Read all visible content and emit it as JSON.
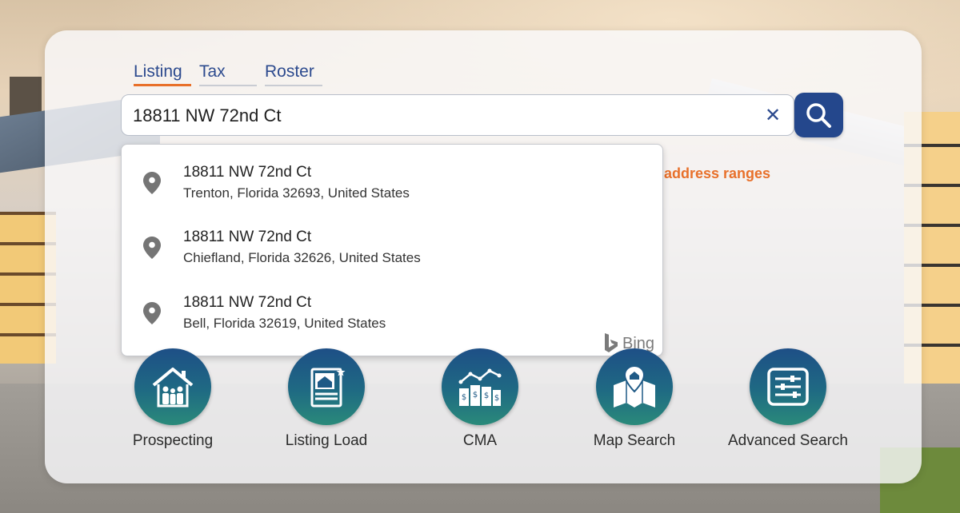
{
  "tabs": [
    {
      "label": "Listing",
      "active": true
    },
    {
      "label": "Tax",
      "active": false
    },
    {
      "label": "Roster",
      "active": false
    }
  ],
  "search": {
    "value": "18811 NW 72nd Ct",
    "clear_icon": "close-icon",
    "search_icon": "search-icon"
  },
  "hint": {
    "text": "address ranges"
  },
  "suggestions": [
    {
      "line1": "18811 NW 72nd Ct",
      "line2": "Trenton, Florida 32693, United States",
      "icon": "map-pin-icon"
    },
    {
      "line1": "18811 NW 72nd Ct",
      "line2": "Chiefland, Florida 32626, United States",
      "icon": "map-pin-icon"
    },
    {
      "line1": "18811 NW 72nd Ct",
      "line2": "Bell, Florida 32619, United States",
      "icon": "map-pin-icon"
    }
  ],
  "provider": {
    "label": "Bing",
    "icon": "bing-logo-icon"
  },
  "actions": [
    {
      "label": "Prospecting",
      "icon": "house-family-icon"
    },
    {
      "label": "Listing Load",
      "icon": "listing-document-icon"
    },
    {
      "label": "CMA",
      "icon": "cma-chart-icon"
    },
    {
      "label": "Map Search",
      "icon": "map-pin-house-icon"
    },
    {
      "label": "Advanced Search",
      "icon": "sliders-icon"
    }
  ],
  "colors": {
    "accent": "#e8702a",
    "brand_blue": "#24478c",
    "tab_text": "#2c4a8e",
    "icon_gradient_top": "#1e4f86",
    "icon_gradient_bottom": "#2a8a7a"
  }
}
